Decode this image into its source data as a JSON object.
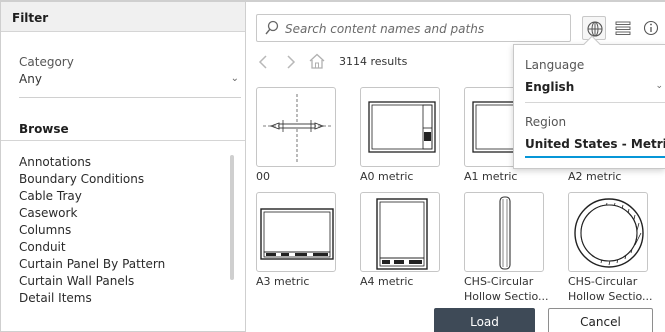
{
  "filter": {
    "title": "Filter",
    "category_label": "Category",
    "category_value": "Any",
    "browse_title": "Browse",
    "browse_items": [
      "Annotations",
      "Boundary Conditions",
      "Cable Tray",
      "Casework",
      "Columns",
      "Conduit",
      "Curtain Panel By Pattern",
      "Curtain Wall Panels",
      "Detail Items"
    ]
  },
  "search": {
    "placeholder": "Search content names and paths",
    "value": ""
  },
  "toolbar": {
    "icons": [
      "globe-icon",
      "list-view-icon",
      "info-icon"
    ]
  },
  "nav": {
    "results_text": "3114 results"
  },
  "tiles": [
    {
      "label": "00",
      "icon": "centerline-drawing"
    },
    {
      "label": "A0 metric",
      "icon": "title-block"
    },
    {
      "label": "A1 metric",
      "icon": "title-block"
    },
    {
      "label": "A2 metric",
      "icon": "title-block"
    },
    {
      "label": "A3 metric",
      "icon": "title-block-landscape"
    },
    {
      "label": "A4 metric",
      "icon": "title-block-portrait"
    },
    {
      "label": "CHS-Circular Hollow Sectio...",
      "label_line1": "CHS-Circular",
      "label_line2": "Hollow Sectio...",
      "icon": "tube-elevation"
    },
    {
      "label": "CHS-Circular Hollow Sectio...",
      "label_line1": "CHS-Circular",
      "label_line2": "Hollow Sectio...",
      "icon": "tube-section"
    }
  ],
  "buttons": {
    "load": "Load",
    "cancel": "Cancel"
  },
  "locale_popup": {
    "language_label": "Language",
    "language_value": "English",
    "region_label": "Region",
    "region_value": "United States - Metric"
  },
  "colors": {
    "primary_button": "#3e4a57",
    "accent_blue": "#0696d7",
    "panel_header": "#f0f0f0"
  }
}
